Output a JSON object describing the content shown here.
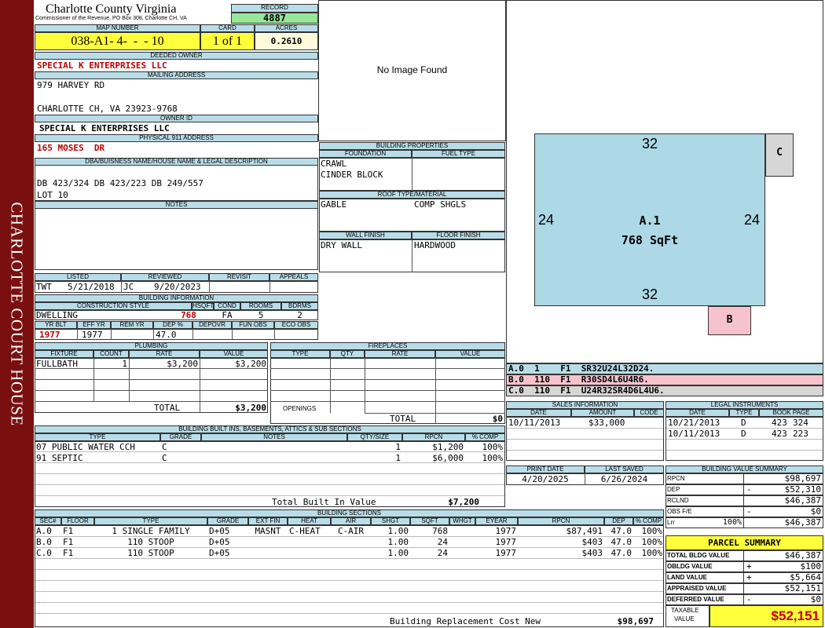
{
  "sidebar": {
    "text": "CHARLOTTE COURT HOUSE"
  },
  "header": {
    "county": "Charlotte County Virginia",
    "address": "Commissioner of the Revenue, PO Box 308, Charlotte CH, VA",
    "record_label": "RECORD",
    "record": "4887",
    "map_label": "MAP NUMBER",
    "map": "038-A1- 4-  -  - 10",
    "card_label": "CARD",
    "card": "1 of 1",
    "acres_label": "ACRES",
    "acres": "0.2610"
  },
  "owner": {
    "deeded_label": "DEEDED OWNER",
    "deeded": "SPECIAL K ENTERPRISES LLC",
    "mailing_label": "MAILING ADDRESS",
    "mail1": "979 HARVEY RD",
    "mail2": "CHARLOTTE CH, VA 23923-9768",
    "ownerid_label": "OWNER ID",
    "ownerid": "SPECIAL K ENTERPRISES LLC",
    "phys_label": "PHYSICAL 911 ADDRESS",
    "phys": "165 MOSES  DR"
  },
  "legal": {
    "label": "DBA/BUISNESS NAME/HOUSE NAME & LEGAL DESCRIPTION",
    "line1": "DB 423/324 DB 423/223 DB 249/557",
    "line2": "LOT 10"
  },
  "notes": {
    "label": "NOTES"
  },
  "listed": {
    "labels": [
      "LISTED",
      "REVIEWED",
      "REVISIT",
      "APPEALS"
    ],
    "listed_by": "TWT",
    "listed_date": "5/21/2018",
    "reviewed_by": "JC",
    "reviewed_date": "9/20/2023"
  },
  "building_info": {
    "label": "BUILDING INFORMATION",
    "labels1": [
      "CONSTRUCTION STYLE",
      "HSQFT",
      "COND",
      "ROOMS",
      "BDRMS"
    ],
    "style": "DWELLING",
    "hsqft": "768",
    "cond": "FA",
    "rooms": "5",
    "bdrms": "2",
    "labels2": [
      "YR BLT",
      "EFF YR",
      "REM YR",
      "DEP %",
      "DEPOVR",
      "FUN OBS",
      "ECO OBS"
    ],
    "yrblt": "1977",
    "effyr": "1977",
    "dep": "47.0"
  },
  "image": {
    "text": "No Image Found"
  },
  "building_props": {
    "label": "BUILDING PROPERTIES",
    "foundation_label": "FOUNDATION",
    "fuel_label": "FUEL TYPE",
    "foundation1": "CRAWL",
    "foundation2": "CINDER BLOCK",
    "roof_label": "ROOF TYPE/MATERIAL",
    "roof1": "GABLE",
    "roof2": "COMP SHGLS",
    "wall_label": "WALL FINISH",
    "floor_label": "FLOOR FINISH",
    "wall": "DRY WALL",
    "floor": "HARDWOOD"
  },
  "sketch": {
    "top": "32",
    "left": "24",
    "right": "24",
    "bottom": "32",
    "area_label": "A.1",
    "area_sqft": "768 SqFt",
    "c_label": "C",
    "b_label": "B"
  },
  "sketch_codes": [
    {
      "text": "A.0  1    F1  SR32U24L32D24.",
      "color": "#b9dde8"
    },
    {
      "text": "B.0  110  F1  R30SD4L6U4R6.",
      "color": "#f6c3cd"
    },
    {
      "text": "C.0  110  F1  U24R32SR4D6L4U6.",
      "color": "#d6d6d6"
    }
  ],
  "plumbing": {
    "label": "PLUMBING",
    "cols": [
      "FIXTURE",
      "COUNT",
      "RATE",
      "VALUE"
    ],
    "fixture": "FULLBATH",
    "count": "1",
    "rate": "$3,200",
    "value": "$3,200",
    "total_label": "TOTAL",
    "total": "$3,200"
  },
  "fireplaces": {
    "label": "FIREPLACES",
    "cols": [
      "TYPE",
      "QTY",
      "RATE",
      "VALUE"
    ],
    "openings_label": "OPENINGS",
    "total_label": "TOTAL",
    "total": "$0"
  },
  "sales": {
    "label": "SALES INFORMATION",
    "cols": [
      "DATE",
      "AMOUNT",
      "CODE"
    ],
    "date": "10/11/2013",
    "amount": "$33,000"
  },
  "legal_instr": {
    "label": "LEGAL INSTRUMENTS",
    "cols": [
      "DATE",
      "TYPE",
      "BOOK PAGE"
    ],
    "rows": [
      {
        "date": "10/21/2013",
        "type": "D",
        "book": "423",
        "page": "324"
      },
      {
        "date": "10/11/2013",
        "type": "D",
        "book": "423",
        "page": "223"
      }
    ]
  },
  "builtins": {
    "label": "BUILDING BUILT INS, BASEMENTS, ATTICS & SUB SECTIONS",
    "cols": [
      "TYPE",
      "GRADE",
      "NOTES",
      "QTY/SIZE",
      "RPCN",
      "% COMP"
    ],
    "rows": [
      {
        "type": "07 PUBLIC WATER CCH",
        "grade": "C",
        "qty": "1",
        "rpcn": "$1,200",
        "comp": "100%"
      },
      {
        "type": "91 SEPTIC",
        "grade": "C",
        "qty": "1",
        "rpcn": "$6,000",
        "comp": "100%"
      }
    ],
    "total_label": "Total Built In Value",
    "total": "$7,200"
  },
  "print": {
    "print_label": "PRINT DATE",
    "saved_label": "LAST SAVED",
    "print_date": "4/20/2025",
    "saved_date": "6/26/2024"
  },
  "bvs": {
    "label": "BUILDING VALUE SUMMARY",
    "rows": [
      {
        "label": "RPCN",
        "sign": "",
        "value": "$98,697"
      },
      {
        "label": "DEP",
        "sign": "-",
        "value": "$52,310"
      },
      {
        "label": "RCLND",
        "sign": "",
        "value": "$46,387"
      },
      {
        "label": "OBS F/E",
        "sign": "-",
        "value": "$0"
      },
      {
        "label": "Lrr",
        "pct": "100%",
        "sign": "",
        "value": "$46,387"
      }
    ]
  },
  "parcel": {
    "label": "PARCEL SUMMARY",
    "rows": [
      {
        "label": "TOTAL BLDG VALUE",
        "sign": "",
        "value": "$46,387"
      },
      {
        "label": "OBLDG VALUE",
        "sign": "+",
        "value": "$100"
      },
      {
        "label": "LAND VALUE",
        "sign": "+",
        "value": "$5,664"
      },
      {
        "label": "APPRAISED VALUE",
        "sign": "",
        "value": "$52,151"
      },
      {
        "label": "DEFERRED VALUE",
        "sign": "-",
        "value": "$0"
      }
    ],
    "taxable_label1": "TAXABLE",
    "taxable_label2": "VALUE",
    "taxable": "$52,151"
  },
  "sections": {
    "label": "BUILDING SECTIONS",
    "cols": [
      "SEC#",
      "FLOOR",
      "TYPE",
      "GRADE",
      "EXT FIN",
      "HEAT",
      "AIR",
      "SHGT",
      "SQFT",
      "WHGT",
      "EYEAR",
      "RPCN",
      "DEP",
      "% COMP"
    ],
    "rows": [
      {
        "sec": "A.0",
        "floor": "F1",
        "type": "1 SINGLE FAMILY",
        "grade": "D+05",
        "ext": "MASNT",
        "heat": "C-HEAT",
        "air": "C-AIR",
        "shgt": "1.00",
        "sqft": "768",
        "eyear": "1977",
        "rpcn": "$87,491",
        "dep": "47.0",
        "comp": "100%"
      },
      {
        "sec": "B.0",
        "floor": "F1",
        "type": "110 STOOP",
        "grade": "D+05",
        "ext": "",
        "heat": "",
        "air": "",
        "shgt": "1.00",
        "sqft": "24",
        "eyear": "1977",
        "rpcn": "$403",
        "dep": "47.0",
        "comp": "100%"
      },
      {
        "sec": "C.0",
        "floor": "F1",
        "type": "110 STOOP",
        "grade": "D+05",
        "ext": "",
        "heat": "",
        "air": "",
        "shgt": "1.00",
        "sqft": "24",
        "eyear": "1977",
        "rpcn": "$403",
        "dep": "47.0",
        "comp": "100%"
      }
    ],
    "total_label": "Building Replacement Cost New",
    "total": "$98,697"
  }
}
